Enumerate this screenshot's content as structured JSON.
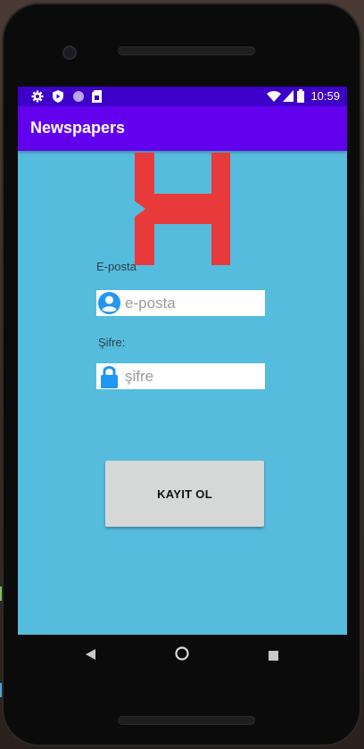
{
  "status_bar": {
    "time": "10:59",
    "icons": [
      "settings-icon",
      "shield-icon",
      "circle-icon",
      "sim-card-icon",
      "wifi-icon",
      "signal-icon",
      "battery-icon"
    ]
  },
  "app_bar": {
    "title": "Newspapers"
  },
  "logo": {
    "icon": "h-logo",
    "color": "#e83a3a"
  },
  "form": {
    "email_label": "E-posta",
    "email_placeholder": "e-posta",
    "password_label": "Şifre:",
    "password_placeholder": "şifre",
    "register_label": "KAYIT OL"
  },
  "nav_bar": {
    "icons": [
      "back-icon",
      "home-icon",
      "recents-icon"
    ]
  },
  "colors": {
    "screen_background": "#56bcde",
    "status_bar": "#3d00c8",
    "app_bar": "#6200ee",
    "icon_blue": "#2196f3"
  }
}
